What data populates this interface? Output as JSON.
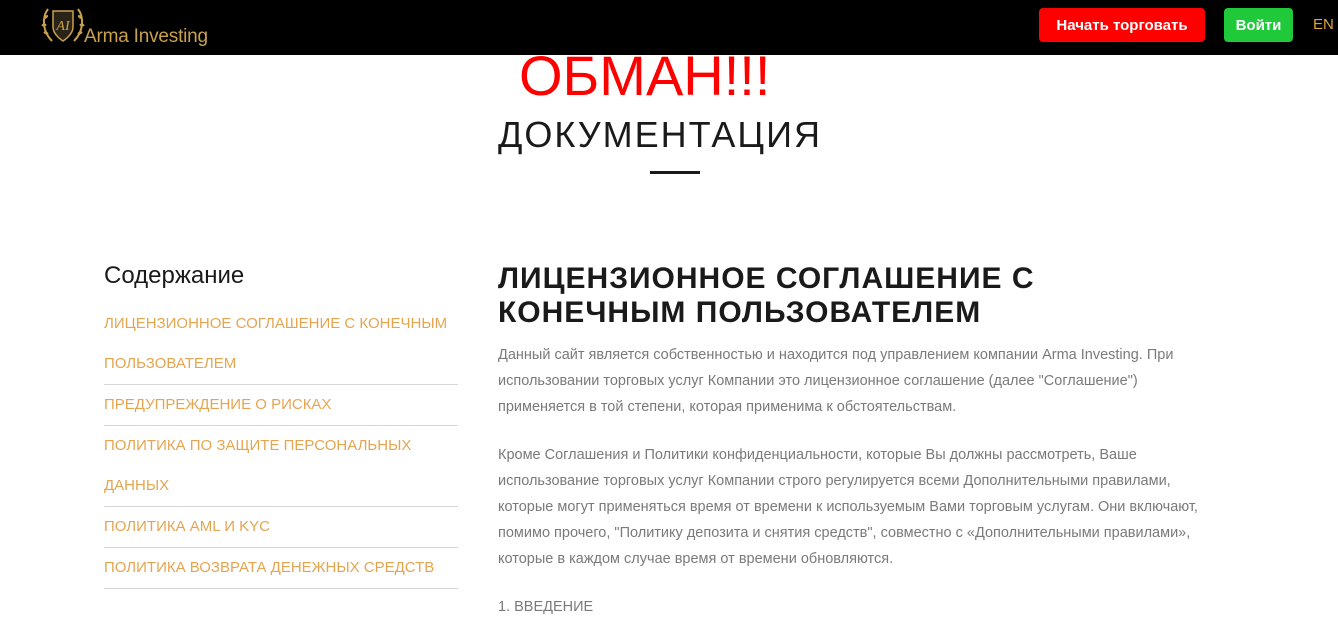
{
  "header": {
    "logo_text": "Arma Investing",
    "logo_monogram": "AI",
    "trade_button": "Начать торговать",
    "login_button": "Войти",
    "language": "EN"
  },
  "overlay": {
    "scam_text": "ОБМАН!!!"
  },
  "page": {
    "title": "ДОКУМЕНТАЦИЯ"
  },
  "toc": {
    "heading": "Содержание",
    "items": [
      "ЛИЦЕНЗИОННОЕ СОГЛАШЕНИЕ С КОНЕЧНЫМ ПОЛЬЗОВАТЕЛЕМ",
      "ПРЕДУПРЕЖДЕНИЕ О РИСКАХ",
      "ПОЛИТИКА ПО ЗАЩИТЕ ПЕРСОНАЛЬНЫХ ДАННЫХ",
      "ПОЛИТИКА AML И KYC",
      "ПОЛИТИКА ВОЗВРАТА ДЕНЕЖНЫХ СРЕДСТВ"
    ]
  },
  "content": {
    "title": "ЛИЦЕНЗИОННОЕ СОГЛАШЕНИЕ С КОНЕЧНЫМ ПОЛЬЗОВАТЕЛЕМ",
    "paragraphs": [
      "Данный сайт является собственностью и находится под управлением компании Arma Investing. При использовании торговых услуг Компании это лицензионное соглашение (далее \"Соглашение\") применяется в той степени, которая применима к обстоятельствам.",
      "Кроме Соглашения и Политики конфиденциальности, которые Вы должны рассмотреть, Ваше использование торговых услуг Компании строго регулируется всеми Дополнительными правилами, которые могут применяться время от времени к используемым Вами торговым услугам. Они включают, помимо прочего, \"Политику депозита и снятия средств\", совместно с «Дополнительными правилами», которые в каждом случае время от времени обновляются."
    ],
    "section_heading": "1. ВВЕДЕНИЕ"
  },
  "colors": {
    "topbar": "#000000",
    "brand_gold": "#c9a14a",
    "trade_button": "#ff0000",
    "login_button": "#1fc93a",
    "link_orange": "#e5a550",
    "scam_red": "#ff0000"
  }
}
